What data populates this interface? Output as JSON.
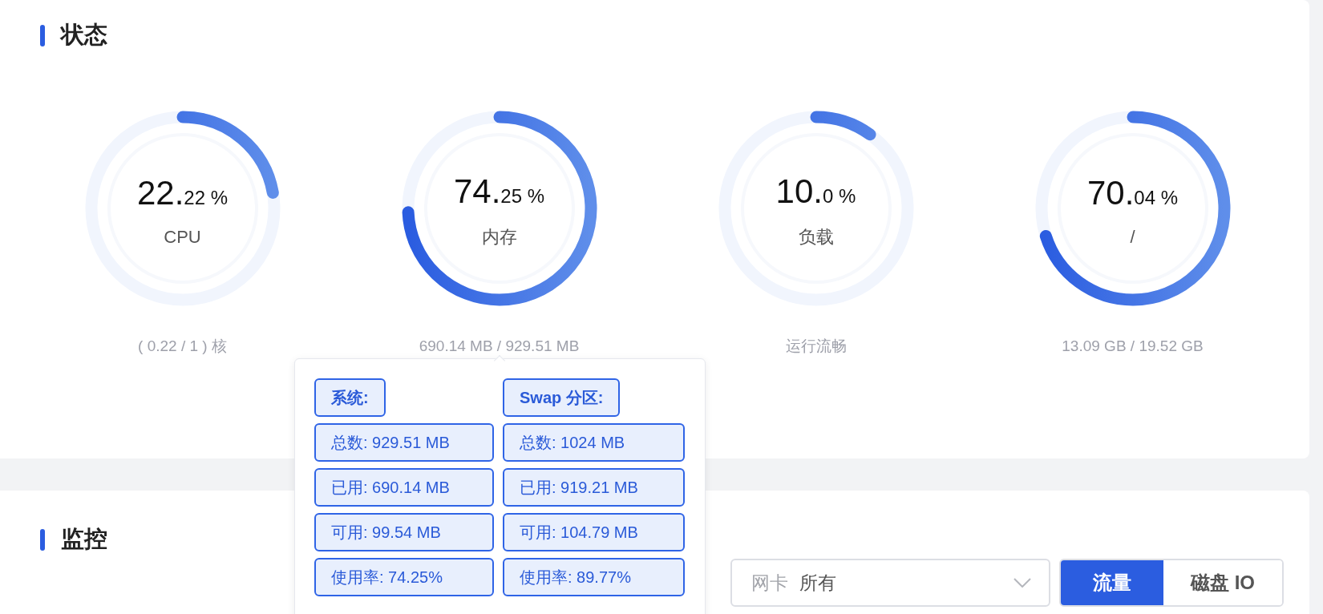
{
  "status": {
    "title": "状态",
    "gauges": [
      {
        "value": "22.",
        "fraction": "22",
        "unit": "%",
        "label": "CPU",
        "detail": "( 0.22 / 1 ) 核",
        "level": 0.2222
      },
      {
        "value": "74.",
        "fraction": "25",
        "unit": "%",
        "label": "内存",
        "detail": "690.14 MB / 929.51 MB",
        "level": 0.7425
      },
      {
        "value": "10.",
        "fraction": "0",
        "unit": "%",
        "label": "负载",
        "detail": "运行流畅",
        "level": 0.1
      },
      {
        "value": "70.",
        "fraction": "04",
        "unit": "%",
        "label": "/",
        "detail": "13.09 GB / 19.52 GB",
        "level": 0.7004
      }
    ]
  },
  "memory_tooltip": {
    "columns": [
      {
        "header": "系统:",
        "rows": [
          "总数: 929.51 MB",
          "已用: 690.14 MB",
          "可用: 99.54 MB",
          "使用率: 74.25%"
        ]
      },
      {
        "header": "Swap 分区:",
        "rows": [
          "总数: 1024 MB",
          "已用: 919.21 MB",
          "可用: 104.79 MB",
          "使用率: 89.77%"
        ]
      }
    ]
  },
  "monitor": {
    "title": "监控",
    "select": {
      "label": "网卡",
      "value": "所有"
    },
    "tabs": [
      {
        "label": "流量",
        "selected": true
      },
      {
        "label": "磁盘 IO",
        "selected": false
      }
    ]
  }
}
